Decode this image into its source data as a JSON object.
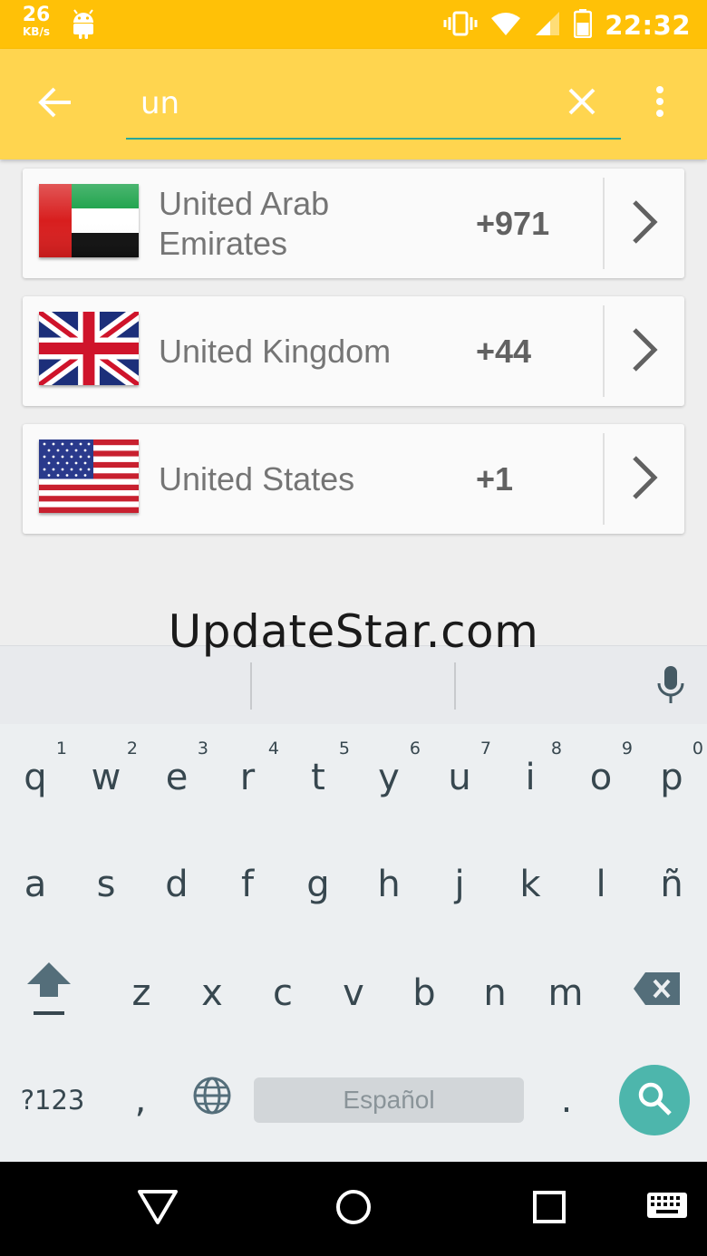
{
  "status_bar": {
    "net_speed": "26",
    "net_speed_unit": "KB/s",
    "time": "22:32",
    "icons": [
      "android-icon",
      "vibrate-icon",
      "wifi-icon",
      "signal-icon",
      "battery-icon"
    ]
  },
  "search": {
    "query": "un",
    "back_icon": "arrow-back-icon",
    "clear_icon": "close-icon",
    "menu_icon": "more-vert-icon",
    "underline_color": "#26a69a"
  },
  "countries": [
    {
      "name": "United Arab Emirates",
      "code": "+971",
      "flag": "uae-flag-icon"
    },
    {
      "name": "United Kingdom",
      "code": "+44",
      "flag": "uk-flag-icon"
    },
    {
      "name": "United States",
      "code": "+1",
      "flag": "us-flag-icon"
    }
  ],
  "watermark": "UpdateStar.com",
  "keyboard": {
    "row1": [
      {
        "key": "q",
        "hint": "1"
      },
      {
        "key": "w",
        "hint": "2"
      },
      {
        "key": "e",
        "hint": "3"
      },
      {
        "key": "r",
        "hint": "4"
      },
      {
        "key": "t",
        "hint": "5"
      },
      {
        "key": "y",
        "hint": "6"
      },
      {
        "key": "u",
        "hint": "7"
      },
      {
        "key": "i",
        "hint": "8"
      },
      {
        "key": "o",
        "hint": "9"
      },
      {
        "key": "p",
        "hint": "0"
      }
    ],
    "row2": [
      "a",
      "s",
      "d",
      "f",
      "g",
      "h",
      "j",
      "k",
      "l",
      "ñ"
    ],
    "row3": [
      "z",
      "x",
      "c",
      "v",
      "b",
      "n",
      "m"
    ],
    "symbols_label": "?123",
    "comma": ",",
    "period": ".",
    "space_label": "Español",
    "accent_color": "#4db6ac"
  },
  "colors": {
    "status_bar": "#ffc107",
    "app_bar": "#ffd54f"
  }
}
